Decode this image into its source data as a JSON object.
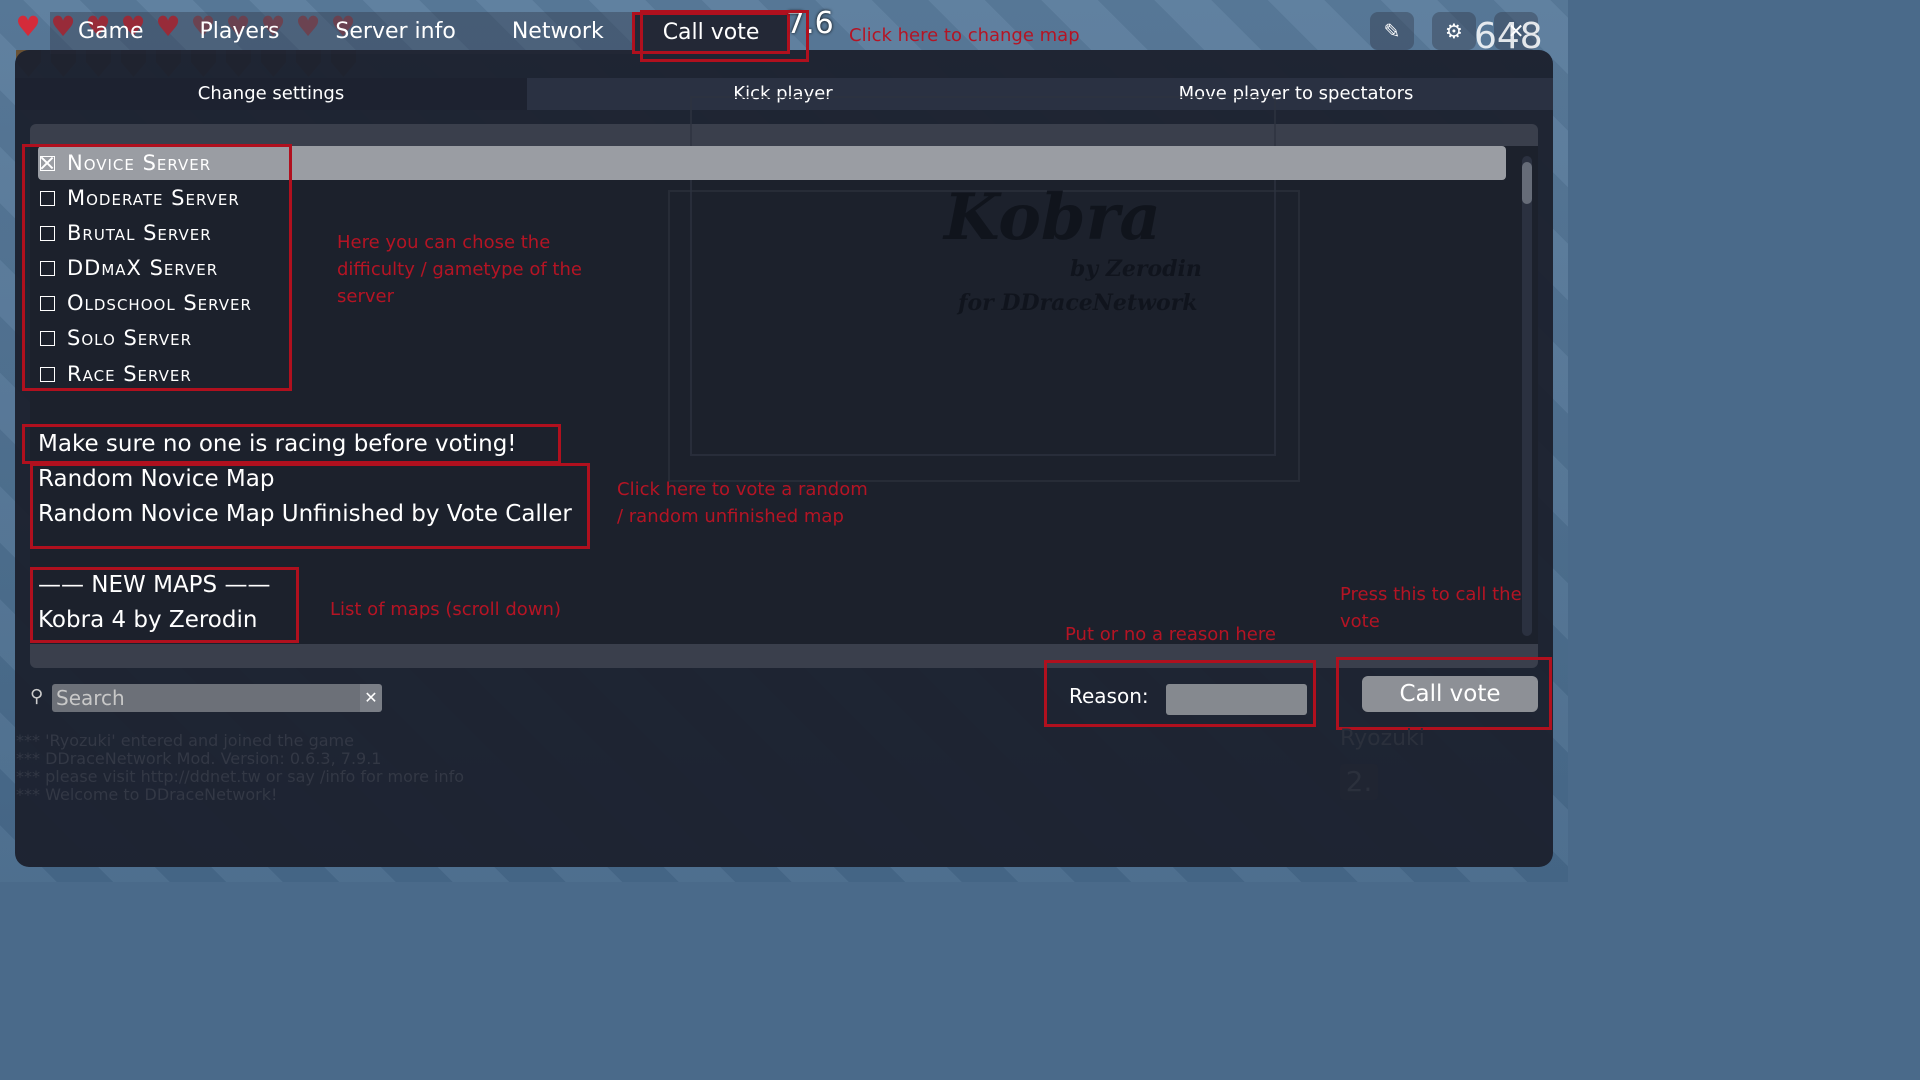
{
  "hud": {
    "timer": "7.6",
    "score": "648"
  },
  "tabs": [
    {
      "label": "Game"
    },
    {
      "label": "Players"
    },
    {
      "label": "Server info"
    },
    {
      "label": "Network"
    },
    {
      "label": "Call vote"
    }
  ],
  "subtabs": [
    {
      "label": "Change settings"
    },
    {
      "label": "Kick player"
    },
    {
      "label": "Move player to spectators"
    }
  ],
  "top_icons": [
    "pencil-icon",
    "gear-icon",
    "close-icon"
  ],
  "servers": [
    {
      "label": "Novice Server",
      "checked": true
    },
    {
      "label": "Moderate Server",
      "checked": false
    },
    {
      "label": "Brutal Server",
      "checked": false
    },
    {
      "label": "DDmaX Server",
      "checked": false
    },
    {
      "label": "Oldschool Server",
      "checked": false
    },
    {
      "label": "Solo Server",
      "checked": false
    },
    {
      "label": "Race Server",
      "checked": false
    }
  ],
  "vote_items": {
    "warning": "Make sure no one is racing before voting!",
    "random_map": "Random Novice Map",
    "random_unfinished": "Random Novice Map Unfinished by Vote Caller",
    "new_maps_header": "—— NEW MAPS ——",
    "map1": "Kobra 4 by Zerodin"
  },
  "map_preview": {
    "title": "Kobra",
    "by": "by Zerodin",
    "for": "for DDraceNetwork"
  },
  "annotations": {
    "change_map": "Click here to change map",
    "difficulty": "Here you can chose the difficulty / gametype of the server",
    "random_vote": "Click here to vote a random / random unfinished map",
    "map_list": "List of maps (scroll down)",
    "reason": "Put or no a reason here",
    "call_vote": "Press this to call the vote"
  },
  "search": {
    "placeholder": "Search"
  },
  "reason": {
    "label": "Reason:",
    "value": ""
  },
  "call_vote_button": "Call vote",
  "chat": [
    "*** 'Ryozuki' entered and joined the game",
    "*** DDraceNetwork Mod. Version: 0.6.3, 7.9.1",
    "*** please visit http://ddnet.tw or say /info for more info",
    "*** Welcome to DDraceNetwork!"
  ],
  "scoreboard": {
    "player": "Ryozuki",
    "rank": "2."
  },
  "colors": {
    "annotation_red": "#b0101e",
    "panel_bg": "#1d2230",
    "selected_row": "#9a9da3"
  }
}
